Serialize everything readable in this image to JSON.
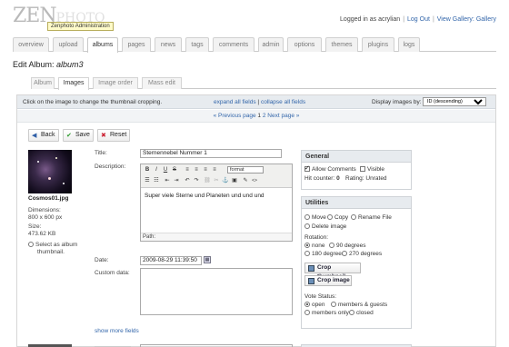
{
  "header": {
    "logo_main": "ZEN",
    "logo_faded": "PHOTO",
    "logo_tooltip": "Zenphoto Administration",
    "logged_in_text": "Logged in as acrylian",
    "logout_link": "Log Out",
    "view_gallery_link": "View Gallery: Gallery"
  },
  "nav": {
    "tabs": [
      "overview",
      "upload",
      "albums",
      "pages",
      "news",
      "tags",
      "comments",
      "admin",
      "options",
      "themes",
      "plugins",
      "logs"
    ],
    "active": "albums"
  },
  "page": {
    "title_prefix": "Edit Album: ",
    "album_name": "album3"
  },
  "subtabs": {
    "items": [
      "Album",
      "Images",
      "Image order",
      "Mass edit"
    ],
    "active": "Images"
  },
  "infobar": {
    "instruction": "Click on the image to change the thumbnail cropping.",
    "expand_all": "expand all fields",
    "separator": " | ",
    "collapse_all": "collapse all fields",
    "display_label": "Display images by:",
    "display_value": "ID (descending)"
  },
  "pager": {
    "prev": "« Previous page",
    "page1": "1",
    "page2": "2",
    "next": "Next page »"
  },
  "actions": {
    "back": "Back",
    "save": "Save",
    "reset": "Reset"
  },
  "image": {
    "filename": "Cosmos01.jpg",
    "dimensions_label": "Dimensions:",
    "dimensions": "800 x 600 px",
    "size_label": "Size:",
    "size": "473.62 KB",
    "set_thumb_line1": "Select as album",
    "set_thumb_line2": "thumbnail."
  },
  "form": {
    "title_label": "Title:",
    "title_value": "Sternennebel Nummer 1",
    "description_label": "Description:",
    "description_value": "Super viele Sterne und Planeten und und und",
    "format_select": "format",
    "path_label": "Path:",
    "date_label": "Date:",
    "date_value": "2009-08-29 11:39:50",
    "custom_label": "Custom data:",
    "show_more": "show more fields"
  },
  "general_box": {
    "heading": "General",
    "allow_comments": "Allow Comments",
    "visible": "Visible",
    "hit_counter_label": "Hit counter:",
    "hit_counter": "0",
    "rating_label": "Rating:",
    "rating": "Unrated"
  },
  "utilities_box": {
    "heading": "Utilities",
    "move": "Move",
    "copy": "Copy",
    "rename": "Rename File",
    "delete": "Delete image",
    "rotation_label": "Rotation:",
    "rot_none": "none",
    "rot_90": "90 degrees",
    "rot_180": "180 degrees",
    "rot_270": "270 degrees",
    "crop_thumbnail": "Crop thumbnail",
    "crop_image": "Crop image",
    "vote_label": "Vote Status:",
    "vote_open": "open",
    "vote_members_guests": "members & guests",
    "vote_members_only": "members only",
    "vote_closed": "closed"
  },
  "colors": {
    "link": "#3366aa",
    "panel_header": "#e7ebef",
    "tooltip_bg": "#fffbc9"
  }
}
